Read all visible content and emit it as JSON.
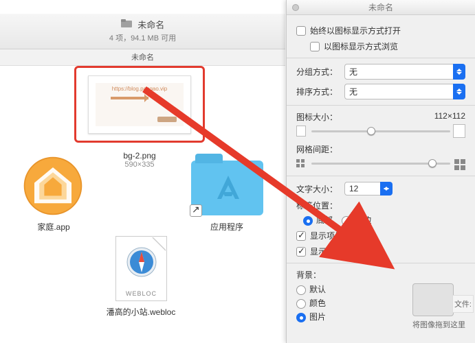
{
  "finder": {
    "title": "未命名",
    "subtitle": "4 项，94.1 MB 可用",
    "path": "未命名",
    "selected": {
      "thumb_url": "https://blog.pangao.vip",
      "filename": "bg-2.png",
      "dimensions": "590×335"
    },
    "items": {
      "home": "家庭.app",
      "apps": "应用程序",
      "webloc_tag": "WEBLOC",
      "webloc_name": "潘高的小站.webloc"
    }
  },
  "inspector": {
    "title": "未命名",
    "always_icon_view": "始终以图标显示方式打开",
    "browse_icon_view": "以图标显示方式浏览",
    "group_by_label": "分组方式：",
    "group_by_value": "无",
    "sort_by_label": "排序方式：",
    "sort_by_value": "无",
    "icon_size_label": "图标大小：",
    "icon_size_value": "112×112",
    "grid_spacing_label": "网格间距：",
    "text_size_label": "文字大小：",
    "text_size_value": "12",
    "label_pos_label": "标签位置：",
    "label_bottom": "底部",
    "label_right": "右边",
    "show_info": "显示项目简介",
    "show_preview": "显示图标预览",
    "bg_label": "背景：",
    "bg_default": "默认",
    "bg_color": "颜色",
    "bg_image": "图片",
    "bg_hint": "将图像拖到这里",
    "side_label": "文件:"
  }
}
